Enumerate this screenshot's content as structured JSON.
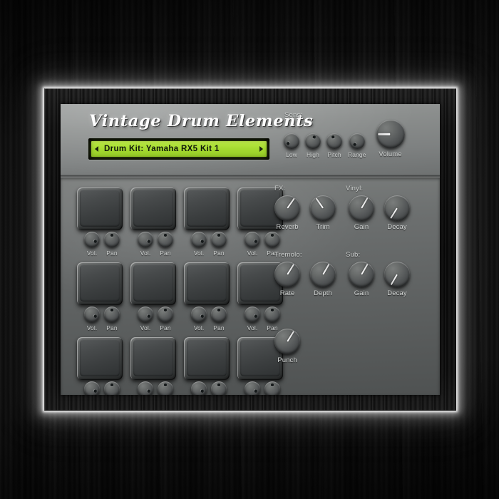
{
  "plugin": {
    "title": "Vintage Drum Elements",
    "preset": {
      "display_text": "Drum Kit: Yamaha RX5 Kit 1",
      "prev_icon": "triangle-left-icon",
      "next_icon": "triangle-right-icon",
      "lcd_color": "#a8de33",
      "lcd_text_color": "#10170a"
    }
  },
  "sens_section": {
    "label": "Sens:",
    "knobs": [
      {
        "label": "Low",
        "rotation": -130
      },
      {
        "label": "High",
        "rotation": 18
      },
      {
        "label": "Pitch",
        "rotation": -18
      },
      {
        "label": "Range",
        "rotation": -150
      }
    ],
    "volume": {
      "label": "Volume",
      "rotation": 90
    }
  },
  "fx_section": {
    "groups": [
      {
        "label": "FX:",
        "knobs": [
          {
            "label": "Reverb",
            "rotation": -145
          },
          {
            "label": "Trim",
            "rotation": 145
          }
        ]
      },
      {
        "label": "Vinyl:",
        "knobs": [
          {
            "label": "Gain",
            "rotation": -150
          },
          {
            "label": "Decay",
            "rotation": 32
          }
        ]
      },
      {
        "label": "Tremolo:",
        "knobs": [
          {
            "label": "Rate",
            "rotation": -148
          },
          {
            "label": "Depth",
            "rotation": -150
          }
        ]
      },
      {
        "label": "Sub:",
        "knobs": [
          {
            "label": "Gain",
            "rotation": -150
          },
          {
            "label": "Decay",
            "rotation": 30
          }
        ]
      }
    ],
    "punch": {
      "label": "Punch",
      "rotation": -148
    }
  },
  "pad_grid": {
    "rows": 3,
    "columns": 4,
    "pad_count": 12,
    "vol_label": "Vol.",
    "pan_label": "Pan",
    "pads": [
      {
        "index": 1,
        "vol_rotation": 118,
        "pan_rotation": 0
      },
      {
        "index": 2,
        "vol_rotation": 118,
        "pan_rotation": 0
      },
      {
        "index": 3,
        "vol_rotation": 118,
        "pan_rotation": 0
      },
      {
        "index": 4,
        "vol_rotation": 118,
        "pan_rotation": 0
      },
      {
        "index": 5,
        "vol_rotation": 118,
        "pan_rotation": 0
      },
      {
        "index": 6,
        "vol_rotation": 118,
        "pan_rotation": 0
      },
      {
        "index": 7,
        "vol_rotation": 118,
        "pan_rotation": 0
      },
      {
        "index": 8,
        "vol_rotation": 118,
        "pan_rotation": 0
      },
      {
        "index": 9,
        "vol_rotation": 118,
        "pan_rotation": 0
      },
      {
        "index": 10,
        "vol_rotation": 118,
        "pan_rotation": 0
      },
      {
        "index": 11,
        "vol_rotation": 118,
        "pan_rotation": 0
      },
      {
        "index": 12,
        "vol_rotation": 118,
        "pan_rotation": 0
      }
    ]
  },
  "theme": {
    "faceplate": "#7b7e7d",
    "body": "#646767",
    "frame": "#101010",
    "label_text": "#d2d5d4",
    "title_text": "#fdfdfd",
    "accent_lcd": "#a8de33"
  }
}
